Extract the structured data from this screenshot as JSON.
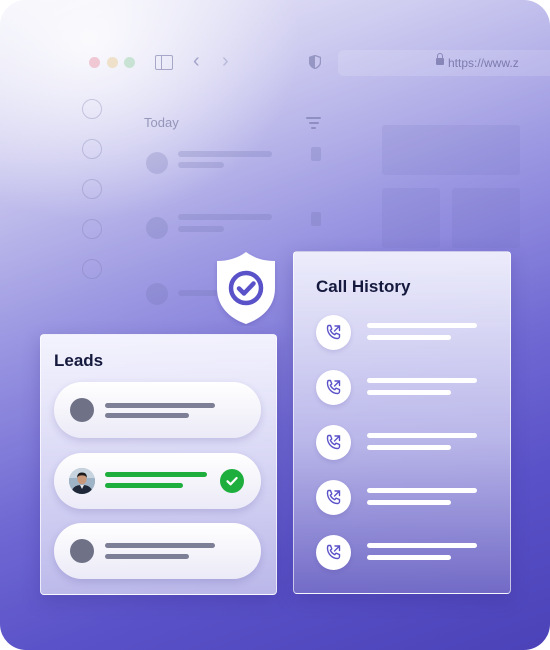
{
  "browser": {
    "url_text": "https://www.z",
    "today_label": "Today"
  },
  "leads": {
    "title": "Leads",
    "items": [
      {
        "state": "pending"
      },
      {
        "state": "verified"
      },
      {
        "state": "pending"
      }
    ]
  },
  "call_history": {
    "title": "Call History",
    "entries": 5
  },
  "colors": {
    "accent": "#5a52c8",
    "success": "#1eae3d",
    "title_text": "#15193d"
  }
}
